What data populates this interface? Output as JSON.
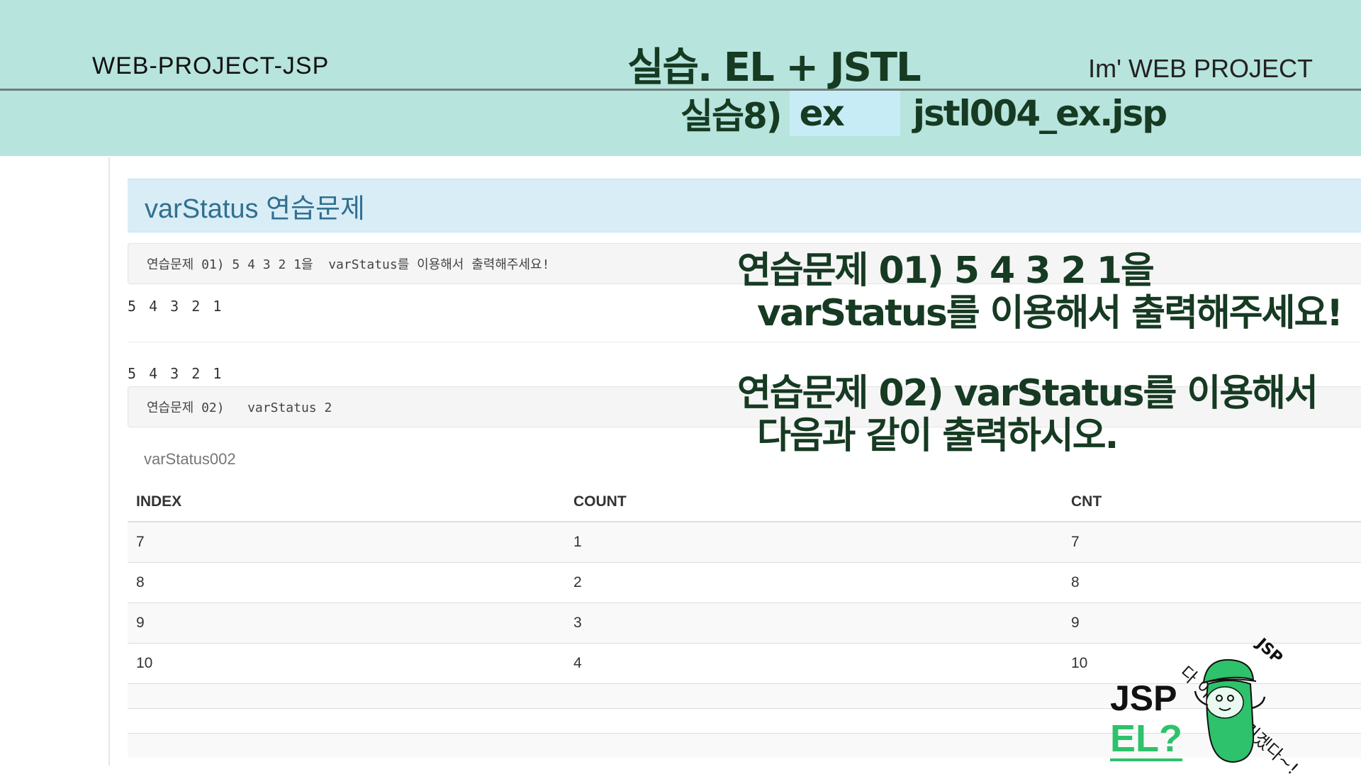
{
  "slide": {
    "brand_left": "WEB-PROJECT-JSP",
    "brand_right": "Im'  WEB PROJECT",
    "title": "실습. EL + JSTL",
    "subtitle_prefix": "실습8)",
    "subtitle_ex": "ex",
    "subtitle_file": "jstl004_ex.jsp"
  },
  "panel": {
    "heading": "varStatus 연습문제",
    "well1": "연습문제 01) 5 4 3 2 1을  varStatus를 이용해서 출력해주세요!",
    "output1": "5 4 3 2 1",
    "output2": "5 4 3 2 1",
    "well2": "연습문제 02)   varStatus 2",
    "caption": "varStatus002",
    "table": {
      "headers": [
        "INDEX",
        "COUNT",
        "CNT"
      ],
      "rows": [
        [
          "7",
          "1",
          "7"
        ],
        [
          "8",
          "2",
          "8"
        ],
        [
          "9",
          "3",
          "9"
        ],
        [
          "10",
          "4",
          "10"
        ]
      ]
    }
  },
  "overlay": {
    "q1_line1": "연습문제 01) 5 4 3 2 1을",
    "q1_line2": "varStatus를 이용해서 출력해주세요!",
    "q2_line1": "연습문제 02) varStatus를 이용해서",
    "q2_line2": "다음과 같이 출력하시오."
  },
  "mascot": {
    "label_jsp": "JSP",
    "label_el": "EL?",
    "speech": "다 이해해버리겠다~!",
    "speech_tag": "JSP"
  },
  "colors": {
    "band": "#b7e4dd",
    "title_text": "#163a22",
    "heading_bg": "#d9edf7",
    "heading_text": "#31708f",
    "mascot_green": "#2dc26b"
  }
}
